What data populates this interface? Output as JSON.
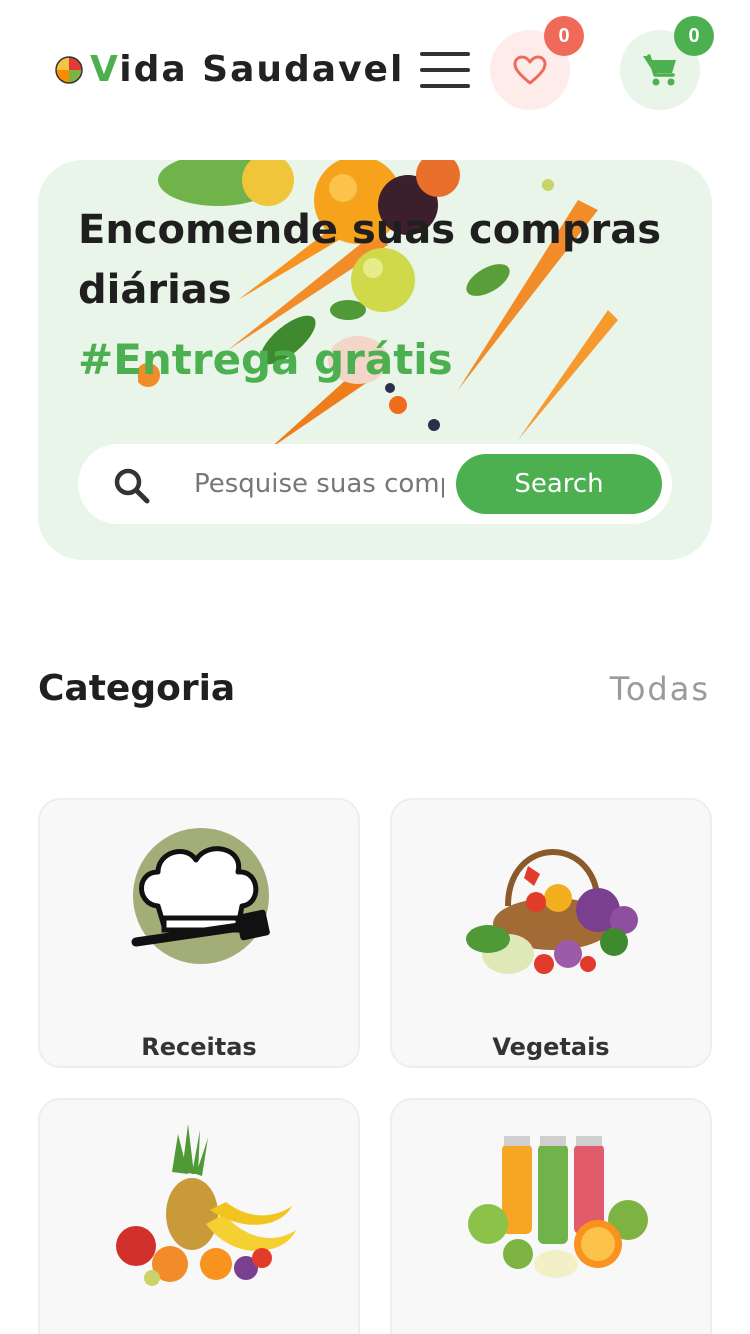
{
  "header": {
    "brand_first_letter": "V",
    "brand_rest": "ida Saudavel",
    "wishlist_count": "0",
    "cart_count": "0",
    "icons": [
      "logo-icon",
      "menu-icon",
      "heart-icon",
      "cart-icon"
    ]
  },
  "hero": {
    "title": "Encomende suas compras diárias",
    "tagline": "#Entrega grátis",
    "search_placeholder": "Pesquise suas compras",
    "search_button": "Search"
  },
  "categories": {
    "title": "Categoria",
    "see_all": "Todas",
    "items": [
      {
        "label": "Receitas",
        "icon": "chef-hat-icon"
      },
      {
        "label": "Vegetais",
        "icon": "vegetable-basket-icon"
      },
      {
        "label": "",
        "icon": "fruits-icon"
      },
      {
        "label": "",
        "icon": "juices-icon"
      }
    ]
  },
  "colors": {
    "primary": "#4caf50",
    "heart": "#f06a5a",
    "hero_bg": "#eaf5ea",
    "wish_bg": "#fdecea",
    "cart_bg": "#e9f5e9"
  }
}
